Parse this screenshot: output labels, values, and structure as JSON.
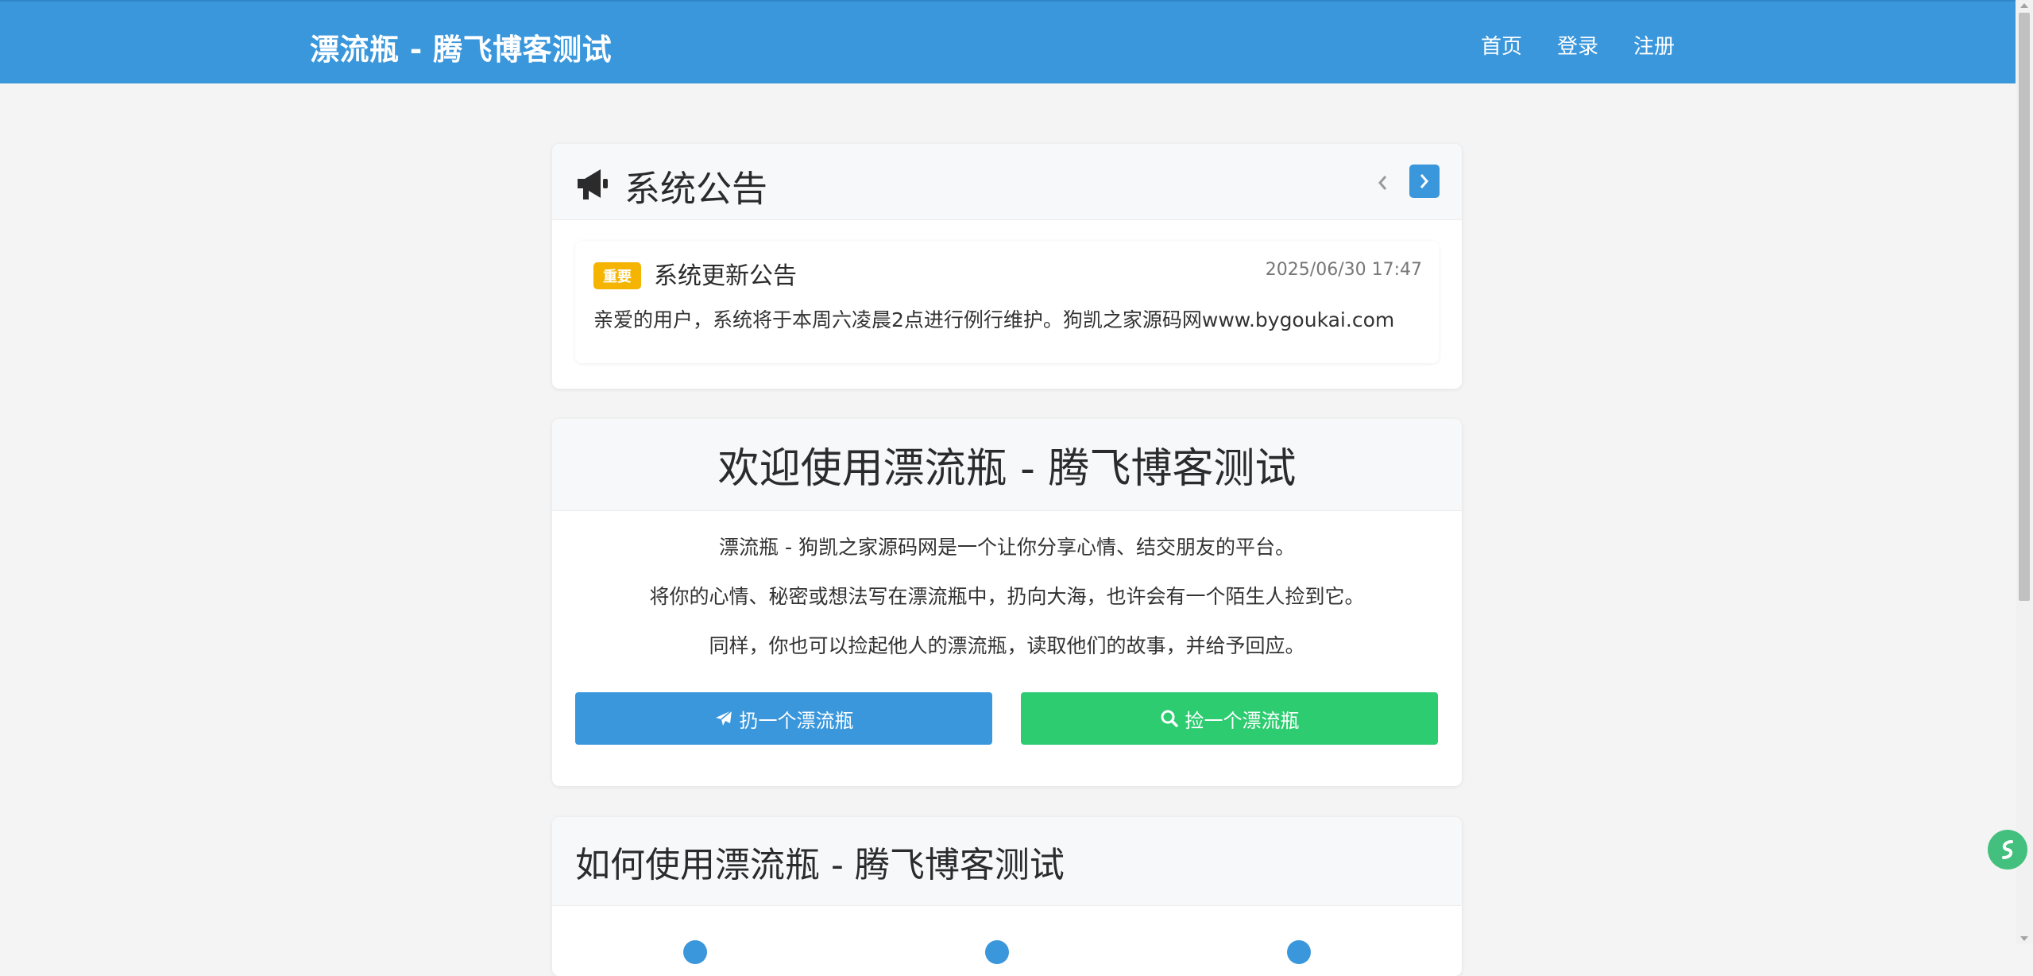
{
  "nav": {
    "brand": "漂流瓶 - 腾飞博客测试",
    "links": [
      "首页",
      "登录",
      "注册"
    ]
  },
  "notice": {
    "header_icon": "bullhorn-icon",
    "title": "系统公告",
    "prev_icon": "chevron-left-icon",
    "next_icon": "chevron-right-icon",
    "item": {
      "badge": "重要",
      "title": "系统更新公告",
      "date": "2025/06/30 17:47",
      "body": "亲爱的用户，系统将于本周六凌晨2点进行例行维护。狗凯之家源码网www.bygoukai.com"
    }
  },
  "welcome": {
    "title": "欢迎使用漂流瓶 - 腾飞博客测试",
    "lines": [
      "漂流瓶 - 狗凯之家源码网是一个让你分享心情、结交朋友的平台。",
      "将你的心情、秘密或想法写在漂流瓶中，扔向大海，也许会有一个陌生人捡到它。",
      "同样，你也可以捡起他人的漂流瓶，读取他们的故事，并给予回应。"
    ],
    "throw_button": "扔一个漂流瓶",
    "pick_button": "捡一个漂流瓶"
  },
  "howto": {
    "title": "如何使用漂流瓶 - 腾飞博客测试"
  },
  "colors": {
    "primary": "#3a97dc",
    "success": "#2ecc71",
    "badge": "#f5b400",
    "background": "#f4f4f4"
  }
}
